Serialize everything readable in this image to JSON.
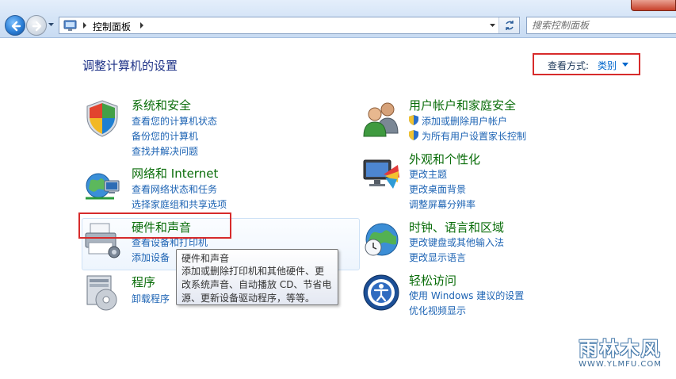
{
  "address_bar": {
    "breadcrumb": "控制面板",
    "search_placeholder": "搜索控制面板"
  },
  "header": {
    "page_title": "调整计算机的设置",
    "view_by_label": "查看方式:",
    "view_by_value": "类别"
  },
  "categories": [
    {
      "title": "系统和安全",
      "icon": "shield-icon",
      "links": [
        "查看您的计算机状态",
        "备份您的计算机",
        "查找并解决问题"
      ]
    },
    {
      "title": "网络和 Internet",
      "icon": "network-globe-icon",
      "links": [
        "查看网络状态和任务",
        "选择家庭组和共享选项"
      ]
    },
    {
      "title": "硬件和声音",
      "icon": "printer-icon",
      "links": [
        "查看设备和打印机",
        "添加设备"
      ]
    },
    {
      "title": "程序",
      "icon": "programs-disc-icon",
      "links": [
        "卸载程序"
      ]
    },
    {
      "title": "用户帐户和家庭安全",
      "icon": "users-icon",
      "links": [
        "添加或删除用户帐户",
        "为所有用户设置家长控制"
      ]
    },
    {
      "title": "外观和个性化",
      "icon": "display-palette-icon",
      "links": [
        "更改主题",
        "更改桌面背景",
        "调整屏幕分辨率"
      ]
    },
    {
      "title": "时钟、语言和区域",
      "icon": "clock-globe-icon",
      "links": [
        "更改键盘或其他输入法",
        "更改显示语言"
      ]
    },
    {
      "title": "轻松访问",
      "icon": "ease-of-access-icon",
      "links": [
        "使用 Windows 建议的设置",
        "优化视频显示"
      ]
    }
  ],
  "tooltip": {
    "title": "硬件和声音",
    "body": "添加或删除打印机和其他硬件、更改系统声音、自动播放 CD、节省电源、更新设备驱动程序，等等。"
  },
  "watermark": {
    "text": "雨林木风",
    "url": "WWW.YLMFU.COM"
  },
  "colors": {
    "category_title": "#0a6d0a",
    "link": "#1e64b4",
    "highlight_box": "#d72b2b",
    "page_title": "#1e3287"
  }
}
